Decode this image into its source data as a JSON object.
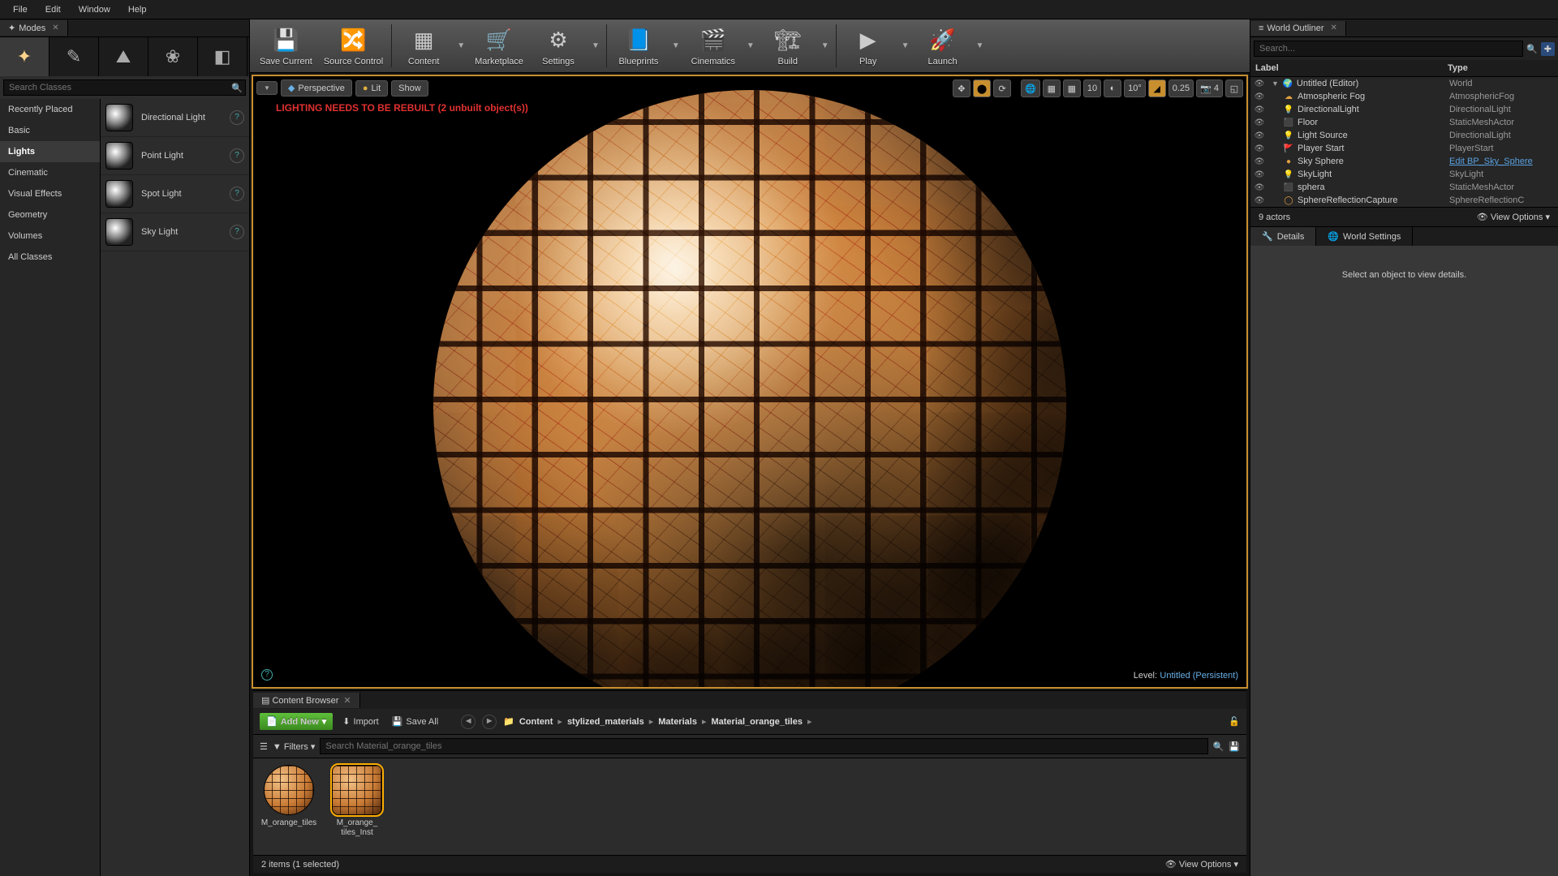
{
  "menu": {
    "file": "File",
    "edit": "Edit",
    "window": "Window",
    "help": "Help"
  },
  "modes": {
    "tab": "Modes",
    "search_placeholder": "Search Classes",
    "categories": [
      "Recently Placed",
      "Basic",
      "Lights",
      "Cinematic",
      "Visual Effects",
      "Geometry",
      "Volumes",
      "All Classes"
    ],
    "selected": "Lights",
    "lights": [
      "Directional Light",
      "Point Light",
      "Spot Light",
      "Sky Light"
    ]
  },
  "toolbar": [
    {
      "label": "Save Current",
      "icon": "save"
    },
    {
      "label": "Source Control",
      "icon": "scm"
    },
    {
      "label": "Content",
      "icon": "content",
      "dd": true
    },
    {
      "label": "Marketplace",
      "icon": "market"
    },
    {
      "label": "Settings",
      "icon": "settings",
      "dd": true
    },
    {
      "label": "Blueprints",
      "icon": "bp",
      "dd": true
    },
    {
      "label": "Cinematics",
      "icon": "cine",
      "dd": true
    },
    {
      "label": "Build",
      "icon": "build",
      "dd": true
    },
    {
      "label": "Play",
      "icon": "play",
      "dd": true
    },
    {
      "label": "Launch",
      "icon": "launch",
      "dd": true
    }
  ],
  "viewport": {
    "perspective": "Perspective",
    "lit": "Lit",
    "show": "Show",
    "warning": "LIGHTING NEEDS TO BE REBUILT (2 unbuilt object(s))",
    "snap_pos": "10",
    "snap_rot": "10°",
    "snap_scale": "0.25",
    "cam_speed": "4",
    "level_label": "Level:",
    "level_name": "Untitled (Persistent)"
  },
  "outliner": {
    "tab": "World Outliner",
    "search_placeholder": "Search...",
    "col_label": "Label",
    "col_type": "Type",
    "rows": [
      {
        "indent": 0,
        "icon": "world",
        "label": "Untitled (Editor)",
        "type": "World"
      },
      {
        "indent": 1,
        "icon": "fog",
        "label": "Atmospheric Fog",
        "type": "AtmosphericFog"
      },
      {
        "indent": 1,
        "icon": "light",
        "label": "DirectionalLight",
        "type": "DirectionalLight"
      },
      {
        "indent": 1,
        "icon": "mesh",
        "label": "Floor",
        "type": "StaticMeshActor"
      },
      {
        "indent": 1,
        "icon": "light",
        "label": "Light Source",
        "type": "DirectionalLight"
      },
      {
        "indent": 1,
        "icon": "player",
        "label": "Player Start",
        "type": "PlayerStart"
      },
      {
        "indent": 1,
        "icon": "sphere",
        "label": "Sky Sphere",
        "type": "Edit BP_Sky_Sphere",
        "link": true
      },
      {
        "indent": 1,
        "icon": "light",
        "label": "SkyLight",
        "type": "SkyLight"
      },
      {
        "indent": 1,
        "icon": "mesh",
        "label": "sphera",
        "type": "StaticMeshActor"
      },
      {
        "indent": 1,
        "icon": "refl",
        "label": "SphereReflectionCapture",
        "type": "SphereReflectionC"
      }
    ],
    "count": "9 actors",
    "view_options": "View Options"
  },
  "details": {
    "tab": "Details",
    "world_tab": "World Settings",
    "empty": "Select an object to view details."
  },
  "cb": {
    "tab": "Content Browser",
    "add": "Add New",
    "import": "Import",
    "save": "Save All",
    "crumbs": [
      "Content",
      "stylized_materials",
      "Materials",
      "Material_orange_tiles"
    ],
    "filters": "Filters",
    "search_placeholder": "Search Material_orange_tiles",
    "assets": [
      {
        "name": "M_orange_tiles"
      },
      {
        "name": "M_orange_tiles_Inst",
        "sel": true
      }
    ],
    "status": "2 items (1 selected)",
    "view_options": "View Options"
  }
}
